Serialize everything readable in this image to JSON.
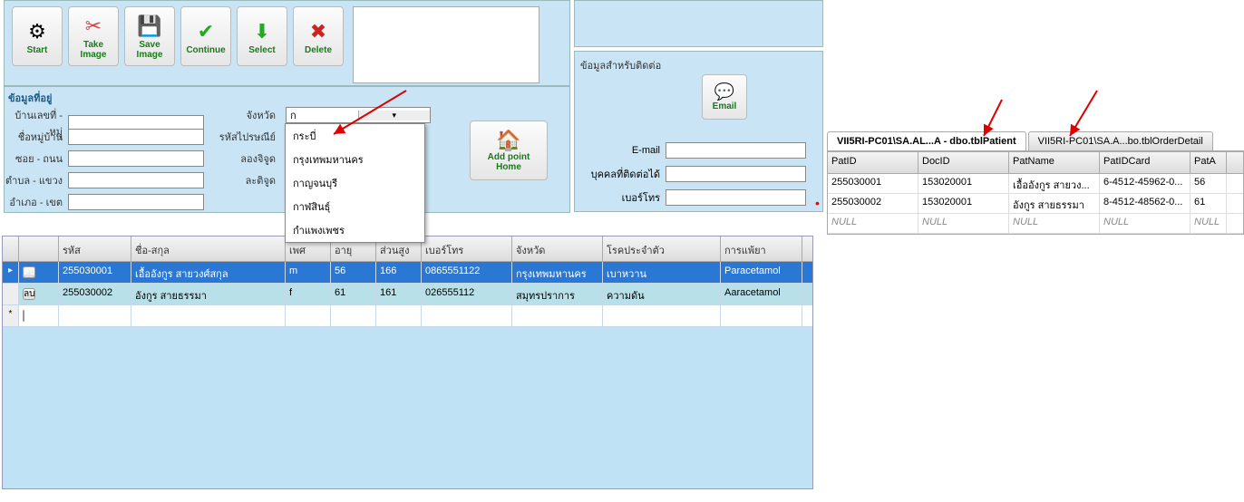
{
  "toolbar": {
    "start": "Start",
    "take_image": "Take\nImage",
    "save_image": "Save\nImage",
    "continue": "Continue",
    "select": "Select",
    "delete": "Delete"
  },
  "addr": {
    "title": "ข้อมูลที่อยู่",
    "house_label": "บ้านเลขที่ - หมู่",
    "village_label": "ชื่อหมู่บ้าน",
    "soi_label": "ซอย - ถนน",
    "tambon_label": "ตำบล - แขวง",
    "amphoe_label": "อำเภอ - เขต",
    "province_label": "จังหวัด",
    "postal_label": "รหัสไปรษณีย์",
    "long_label": "ลองจิจูด",
    "lat_label": "ละติจูด",
    "province_value": "ก",
    "province_options": [
      "กระบี่",
      "กรุงเทพมหานคร",
      "กาญจนบุรี",
      "กาฬสินธุ์",
      "กำแพงเพชร"
    ],
    "add_point": "Add point\nHome"
  },
  "contact": {
    "title": "ข้อมูลสำหรับติดต่อ",
    "email_btn": "Email",
    "email_label": "E-mail",
    "person_label": "บุคคลที่ติดต่อได้",
    "phone_label": "เบอร์โทร"
  },
  "grid": {
    "headers": [
      "รหัส",
      "ชื่อ-สกุล",
      "เพศ",
      "อายุ",
      "ส่วนสูง",
      "เบอร์โทร",
      "จังหวัด",
      "โรคประจำตัว",
      "การแพ้ยา"
    ],
    "del_label": "ลบ",
    "rows": [
      {
        "id": "255030001",
        "name": "เอื้ออังกูร สายวงศ์สกุล",
        "sex": "m",
        "age": "56",
        "height": "166",
        "phone": "0865551122",
        "province": "กรุงเทพมหานคร",
        "disease": "เบาหวาน",
        "allergy": "Paracetamol"
      },
      {
        "id": "255030002",
        "name": "อังกูร สายธรรมา",
        "sex": "f",
        "age": "61",
        "height": "161",
        "phone": "026555112",
        "province": "สมุทรปราการ",
        "disease": "ความดัน",
        "allergy": "Aaracetamol"
      }
    ]
  },
  "tabs": {
    "active": "VII5RI-PC01\\SA.AL...A - dbo.tblPatient",
    "other": "VII5RI-PC01\\SA.A...bo.tblOrderDetail"
  },
  "rgrid": {
    "headers": [
      "PatID",
      "DocID",
      "PatName",
      "PatIDCard",
      "PatA"
    ],
    "rows": [
      {
        "PatID": "255030001",
        "DocID": "153020001",
        "PatName": "เอื้ออังกูร สายวง...",
        "PatIDCard": "6-4512-45962-0...",
        "PatA": "56"
      },
      {
        "PatID": "255030002",
        "DocID": "153020001",
        "PatName": "อังกูร สายธรรมา",
        "PatIDCard": "8-4512-48562-0...",
        "PatA": "61"
      }
    ],
    "null_text": "NULL"
  }
}
